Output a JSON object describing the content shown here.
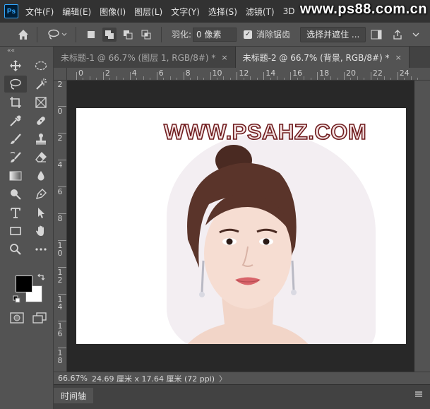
{
  "menubar": {
    "logo": "Ps",
    "items": [
      "文件(F)",
      "编辑(E)",
      "图像(I)",
      "图层(L)",
      "文字(Y)",
      "选择(S)",
      "滤镜(T)",
      "3D"
    ],
    "watermark": "www.ps88.com.cn"
  },
  "options": {
    "feather_label": "羽化:",
    "feather_value": "0 像素",
    "antialias_label": "消除锯齿",
    "antialias_checked": true,
    "select_mask_label": "选择并遮住 ..."
  },
  "tabs": [
    {
      "label": "未标题-1 @ 66.7% (图层 1, RGB/8#) *",
      "close": "×",
      "active": false
    },
    {
      "label": "未标题-2 @ 66.7% (背景, RGB/8#) *",
      "close": "×",
      "active": true
    }
  ],
  "ruler": {
    "h_ticks": [
      "0",
      "2",
      "4",
      "6",
      "8",
      "10",
      "12",
      "14",
      "16",
      "18",
      "20",
      "22",
      "24"
    ],
    "v_ticks": [
      "2",
      "0",
      "2",
      "4",
      "6",
      "8",
      "1\n0",
      "1\n2",
      "1\n4",
      "1\n6",
      "1\n8"
    ]
  },
  "canvas": {
    "site_watermark": "WWW.PSAHZ.COM"
  },
  "status": {
    "zoom": "66.67%",
    "doc_size": "24.69 厘米 x 17.64 厘米 (72 ppi)",
    "arrow": "〉"
  },
  "timeline": {
    "tab_label": "时间轴"
  },
  "toolbar": {
    "collapse": "««",
    "tools": [
      [
        "move-icon",
        "marquee-ellipse-icon"
      ],
      [
        "lasso-icon",
        "magic-wand-icon"
      ],
      [
        "crop-icon",
        "frame-icon"
      ],
      [
        "eyedropper-icon",
        "healing-brush-icon"
      ],
      [
        "brush-icon",
        "clone-stamp-icon"
      ],
      [
        "history-brush-icon",
        "eraser-icon"
      ],
      [
        "gradient-icon",
        "blur-icon"
      ],
      [
        "dodge-icon",
        "pen-icon"
      ],
      [
        "type-icon",
        "path-select-icon"
      ],
      [
        "rectangle-icon",
        "hand-icon"
      ],
      [
        "zoom-icon",
        "more-tools-icon"
      ]
    ],
    "active_tool": "lasso-icon"
  },
  "colors": {
    "foreground": "#000000",
    "background": "#ffffff",
    "app_bg": "#535353",
    "menubar_bg": "#323232",
    "canvas_bg": "#282828"
  }
}
